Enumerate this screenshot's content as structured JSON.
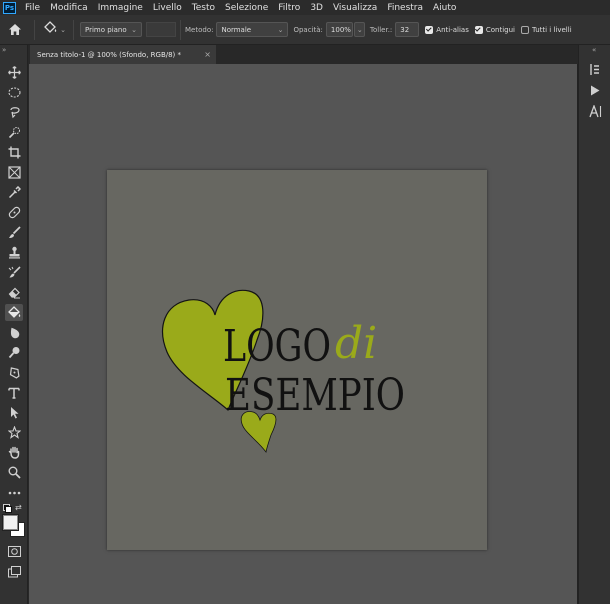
{
  "app": {
    "logo": "Ps"
  },
  "menu": [
    "File",
    "Modifica",
    "Immagine",
    "Livello",
    "Testo",
    "Selezione",
    "Filtro",
    "3D",
    "Visualizza",
    "Finestra",
    "Aiuto"
  ],
  "options": {
    "fill_source": "Primo piano",
    "mode_label": "Metodo:",
    "mode_value": "Normale",
    "opacity_label": "Opacità:",
    "opacity_value": "100%",
    "tolerance_label": "Toller.:",
    "tolerance_value": "32",
    "antialias_label": "Anti-alias",
    "antialias_checked": true,
    "contiguous_label": "Contigui",
    "contiguous_checked": true,
    "all_layers_label": "Tutti i livelli",
    "all_layers_checked": false
  },
  "document": {
    "tab_title": "Senza titolo-1 @ 100% (Sfondo, RGB/8) *",
    "close_glyph": "×",
    "canvas_color": "#676761",
    "logo": {
      "line1": "LOGO",
      "script_word": "di",
      "line2": "ESEMPIO",
      "heart_color": "#9aaa1a",
      "text_color": "#111111"
    }
  },
  "tools": [
    "move-tool-icon",
    "marquee-tool-icon",
    "lasso-tool-icon",
    "quick-selection-tool-icon",
    "crop-tool-icon",
    "frame-tool-icon",
    "eyedropper-tool-icon",
    "healing-brush-tool-icon",
    "brush-tool-icon",
    "clone-stamp-tool-icon",
    "history-brush-tool-icon",
    "eraser-tool-icon",
    "paint-bucket-tool-icon",
    "blur-tool-icon",
    "dodge-tool-icon",
    "pen-tool-icon",
    "type-tool-icon",
    "path-selection-tool-icon",
    "shape-tool-icon",
    "hand-tool-icon",
    "zoom-tool-icon",
    "more-tools-icon"
  ],
  "colors": {
    "foreground": "#f2f2f2",
    "background": "#ffffff",
    "accent": "#9aaa1a"
  }
}
